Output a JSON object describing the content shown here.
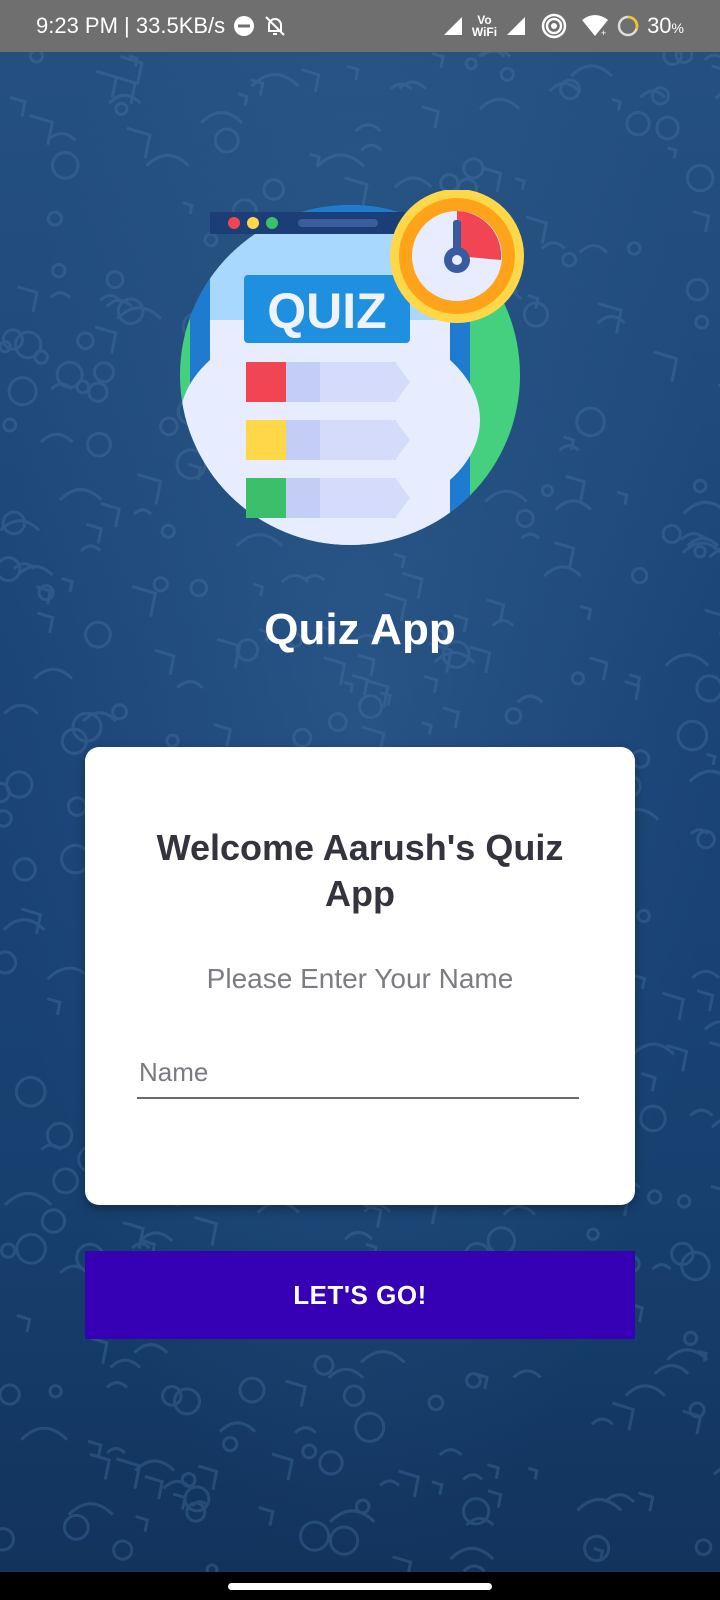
{
  "status_bar": {
    "time_speed": "9:23 PM | 33.5KB/s",
    "vowifi_top": "Vo",
    "vowifi_bottom": "WiFi",
    "battery": "30",
    "battery_unit": "%",
    "icons": [
      "dnd-icon",
      "bell-off-icon",
      "signal-icon",
      "vowifi-icon",
      "signal-icon",
      "hotspot-icon",
      "wifi-icon",
      "battery-ring-icon"
    ]
  },
  "logo": {
    "word": "QUIZ",
    "colors": {
      "circle": "#45d07f",
      "frame": "#1e7bd0",
      "accent_red": "#f24553",
      "accent_yellow": "#ffd84a",
      "accent_green": "#3bbf6a",
      "timer": "#ffa41a"
    }
  },
  "app": {
    "title": "Quiz App"
  },
  "card": {
    "title": "Welcome Aarush's Quiz App",
    "subtitle": "Please Enter Your Name",
    "name_input": {
      "placeholder": "Name",
      "value": ""
    }
  },
  "action": {
    "button_label": "LET'S GO!",
    "color": "#3600b5"
  }
}
